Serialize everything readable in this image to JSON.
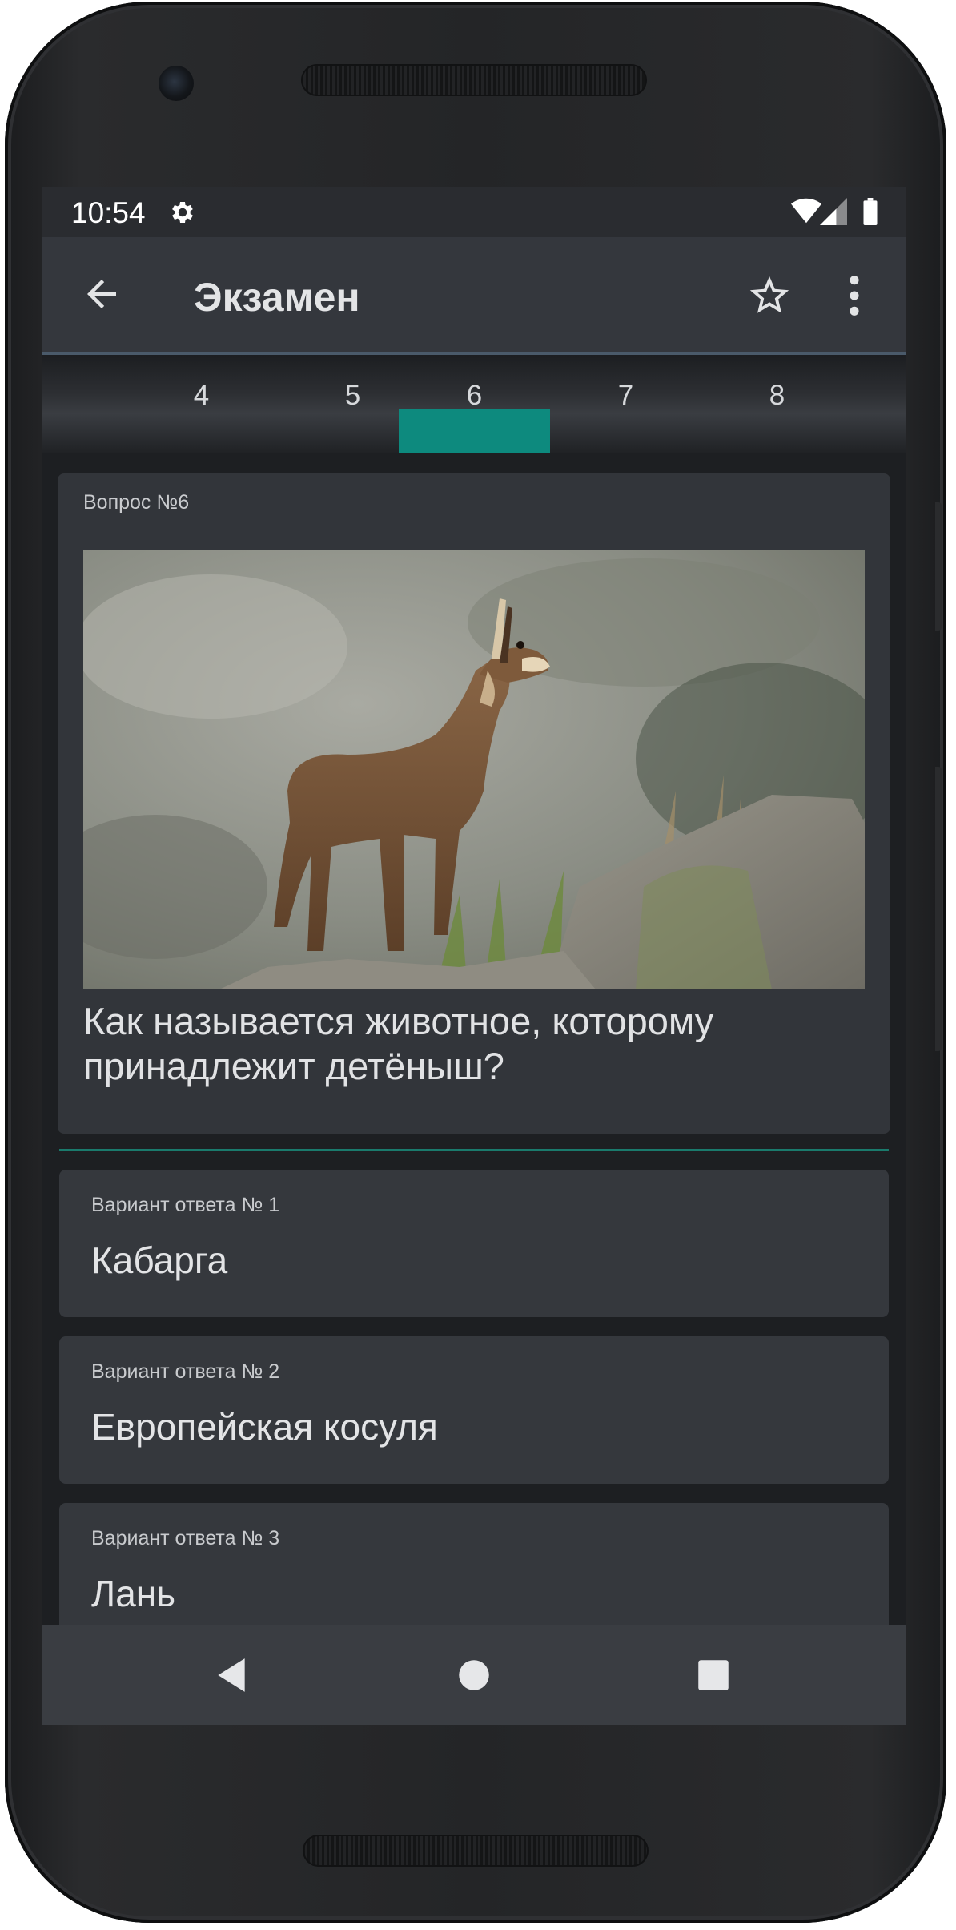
{
  "status_bar": {
    "time": "10:54"
  },
  "app_bar": {
    "title": "Экзамен"
  },
  "tabs": [
    {
      "label": "4",
      "active": false
    },
    {
      "label": "5",
      "active": false
    },
    {
      "label": "6",
      "active": true
    },
    {
      "label": "7",
      "active": false
    },
    {
      "label": "8",
      "active": false
    }
  ],
  "question": {
    "number_label": "Вопрос №6",
    "image_alt": "chamois-kid-photo",
    "text": "Как называется животное, которому принадлежит детёныш?"
  },
  "answers": [
    {
      "label": "Вариант ответа № 1",
      "text": "Кабарга"
    },
    {
      "label": "Вариант ответа № 2",
      "text": "Европейская косуля"
    },
    {
      "label": "Вариант ответа № 3",
      "text": "Лань"
    }
  ],
  "icons": {
    "settings": "gear-icon",
    "wifi": "wifi-icon",
    "signal": "signal-icon",
    "battery": "battery-icon",
    "back": "arrow-back-icon",
    "favorite": "star-outline-icon",
    "menu": "more-vert-icon",
    "nav_back": "nav-back-icon",
    "nav_home": "nav-home-icon",
    "nav_recents": "nav-recents-icon"
  },
  "colors": {
    "accent": "#0d8a7e",
    "surface": "#32353a",
    "background": "#1d1f22",
    "app_bar": "#34373d"
  }
}
